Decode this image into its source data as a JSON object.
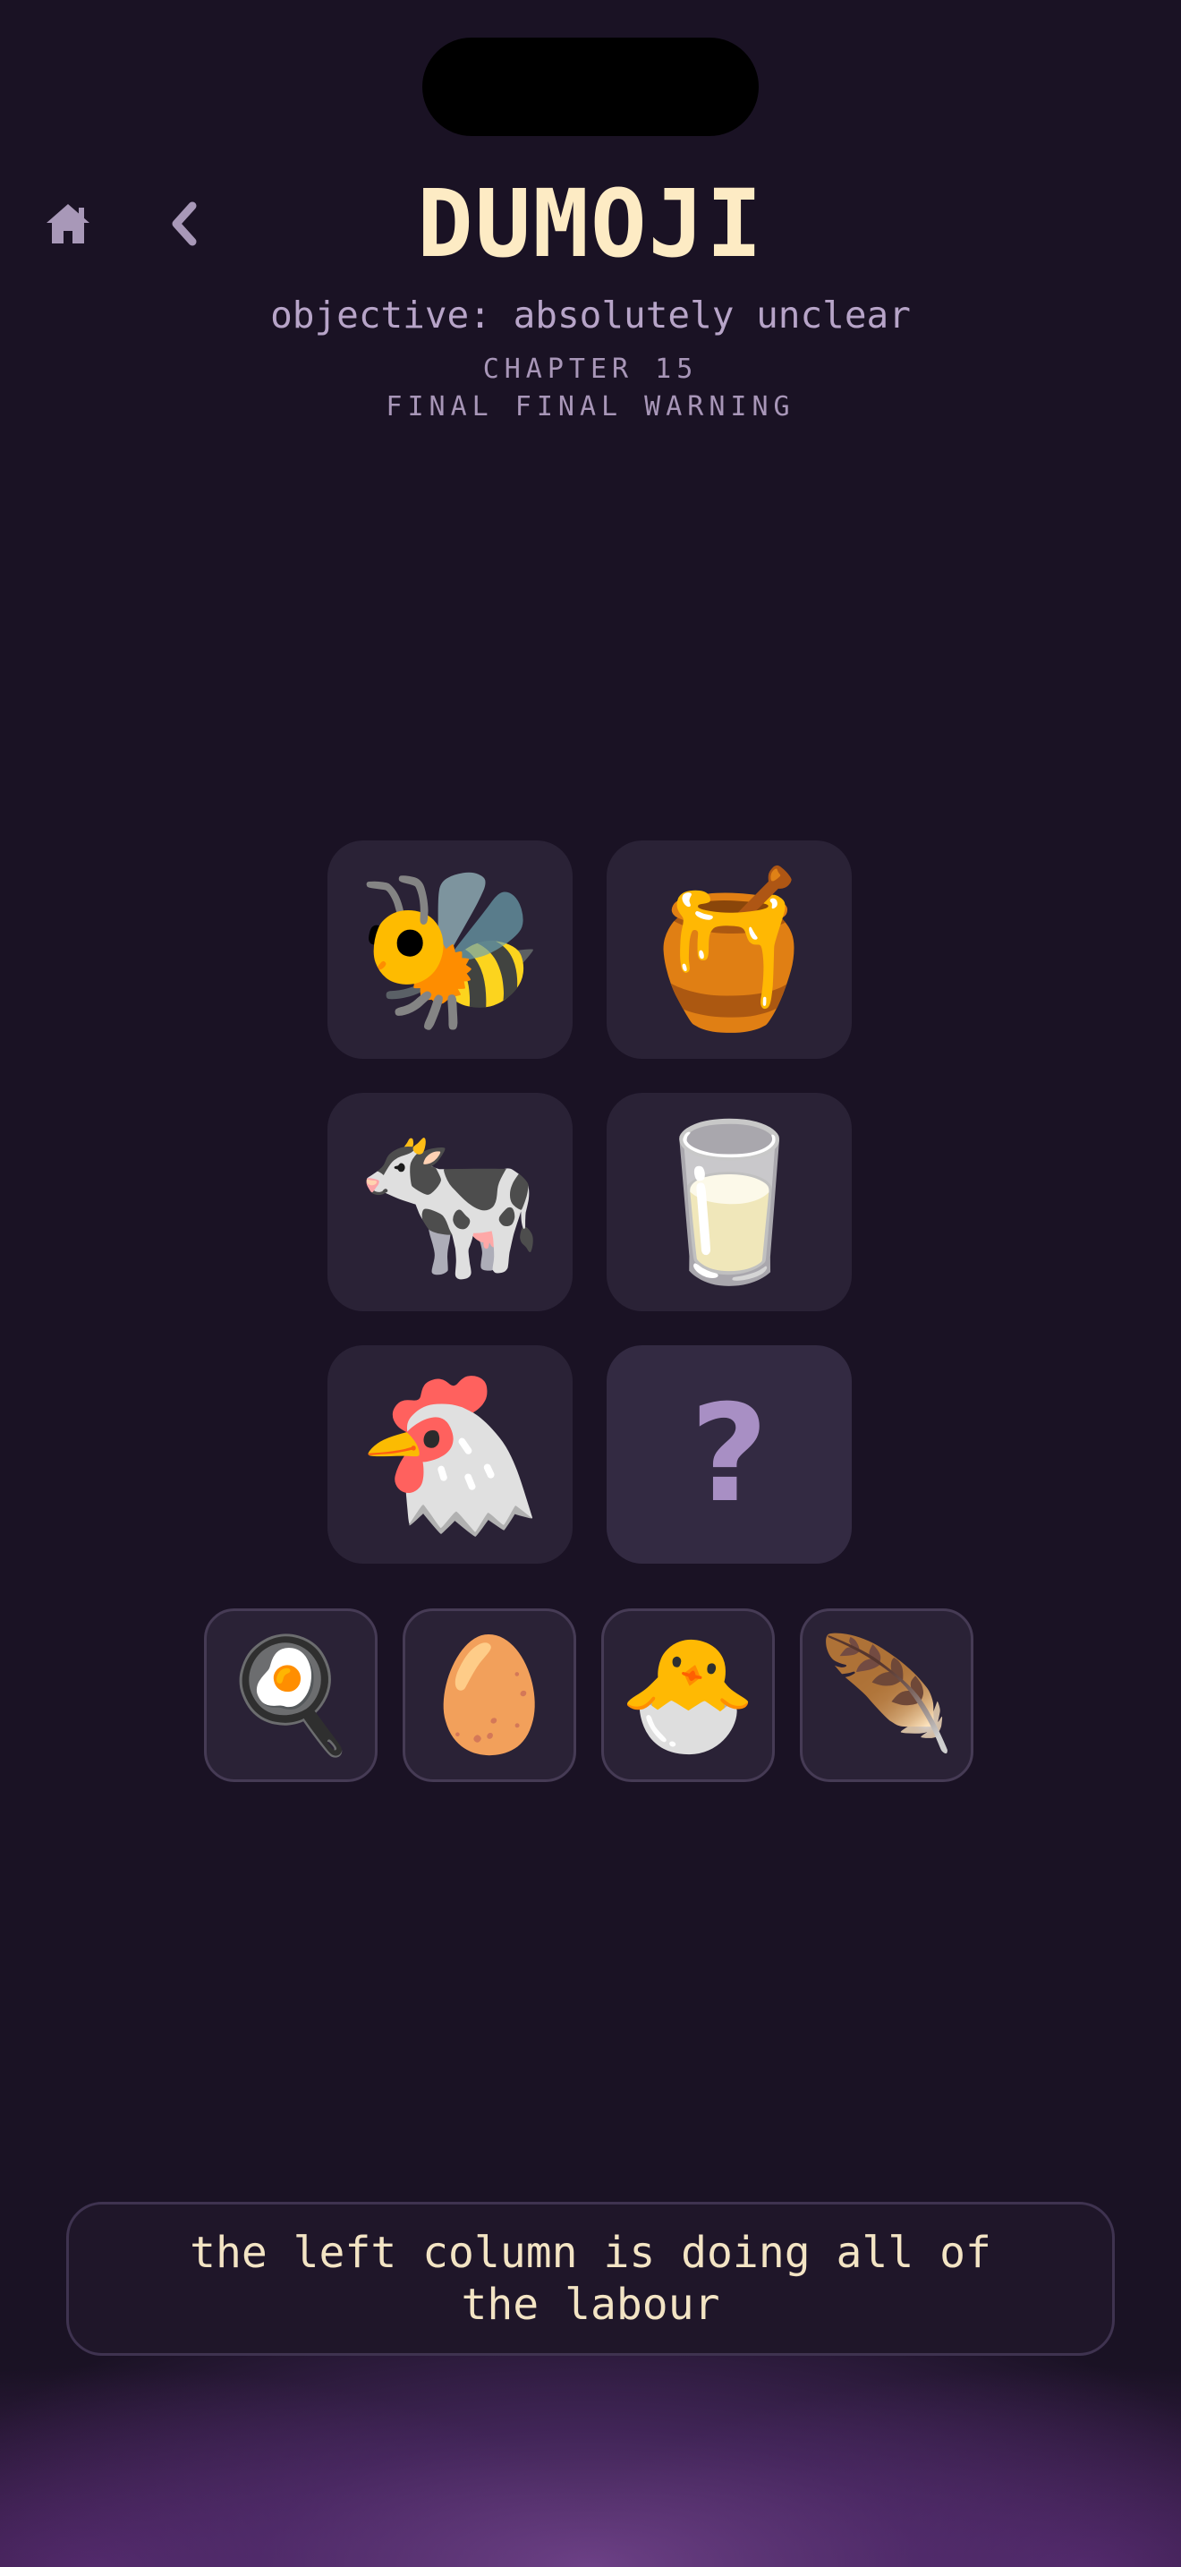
{
  "header": {
    "title": "DUMOJI",
    "objective": "objective: absolutely unclear",
    "chapter": "CHAPTER 15",
    "chapter_subtitle": "FINAL FINAL WARNING"
  },
  "nav": {
    "home_icon": "home-icon",
    "back_icon": "chevron-left-icon"
  },
  "puzzle": {
    "grid": [
      [
        "🐝",
        "🍯"
      ],
      [
        "🐄",
        "🥛"
      ],
      [
        "🐔",
        "?"
      ]
    ]
  },
  "choices": [
    "🍳",
    "🥚",
    "🐣",
    "🪶"
  ],
  "hint": "the left column is doing all of the labour",
  "colors": {
    "background": "#1a1224",
    "title": "#fdebc4",
    "muted_text": "#b7a4c8",
    "tile": "#2a2236",
    "question_mark": "#a88fc4",
    "glow": "#7a4896"
  }
}
